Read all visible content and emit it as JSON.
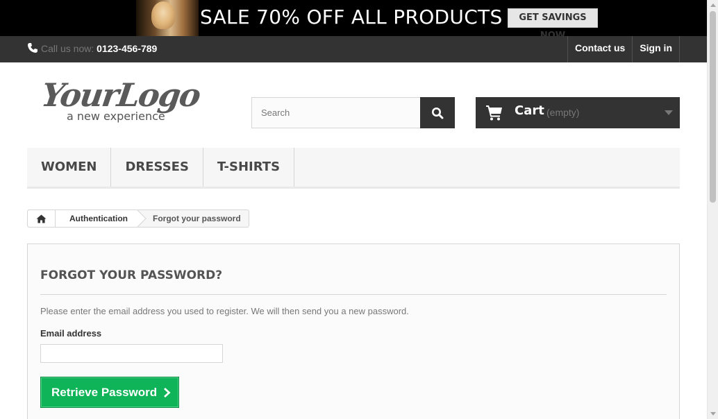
{
  "promo": {
    "title": "SALE 70% OFF ALL PRODUCTS",
    "button": "GET SAVINGS NOW"
  },
  "topnav": {
    "phone_prefix": "Call us now:",
    "phone_number": "0123-456-789",
    "links": [
      "Contact us",
      "Sign in"
    ]
  },
  "logo": {
    "text": "YourLogo",
    "tagline": "a new experience"
  },
  "search": {
    "placeholder": "Search"
  },
  "cart": {
    "label": "Cart",
    "status": "(empty)"
  },
  "menu": {
    "items": [
      "Women",
      "Dresses",
      "T-shirts"
    ]
  },
  "breadcrumb": {
    "items": [
      "Authentication"
    ],
    "current": "Forgot your password"
  },
  "forgot": {
    "title": "Forgot your password?",
    "description": "Please enter the email address you used to register. We will then send you a new password.",
    "email_label": "Email address",
    "email_value": "",
    "submit_label": "Retrieve Password"
  },
  "colors": {
    "accent_green": "#0eb457",
    "dark_bar": "#333333"
  }
}
